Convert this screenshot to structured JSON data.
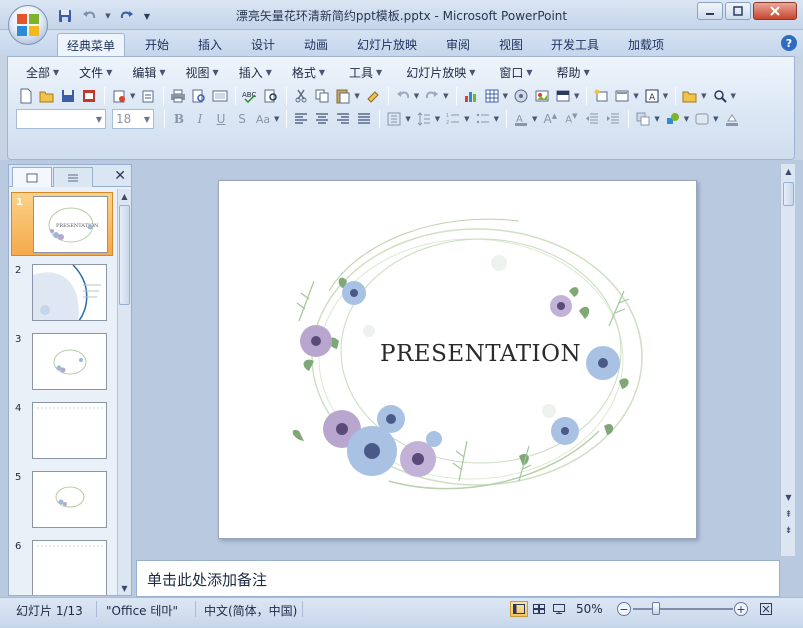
{
  "window": {
    "title": "漂亮矢量花环清新简约ppt模板.pptx - Microsoft PowerPoint"
  },
  "ribbon_tabs": [
    "经典菜单",
    "开始",
    "插入",
    "设计",
    "动画",
    "幻灯片放映",
    "审阅",
    "视图",
    "开发工具",
    "加载项"
  ],
  "classic_menu": [
    {
      "label": "全部"
    },
    {
      "label": "文件"
    },
    {
      "label": "编辑"
    },
    {
      "label": "视图"
    },
    {
      "label": "插入"
    },
    {
      "label": "格式"
    },
    {
      "label": "工具"
    },
    {
      "label": "幻灯片放映"
    },
    {
      "label": "窗口"
    },
    {
      "label": "帮助"
    }
  ],
  "toolbar": {
    "font_name": "",
    "font_size": "18"
  },
  "thumbnails": [
    {
      "number": "1",
      "selected": true
    },
    {
      "number": "2",
      "selected": false
    },
    {
      "number": "3",
      "selected": false
    },
    {
      "number": "4",
      "selected": false
    },
    {
      "number": "5",
      "selected": false
    },
    {
      "number": "6",
      "selected": false
    }
  ],
  "slide": {
    "title_text": "PRESENTATION"
  },
  "notes": {
    "placeholder": "单击此处添加备注"
  },
  "statusbar": {
    "slide_info": "幻灯片 1/13",
    "theme": "\"Office 테마\"",
    "language": "中文(简体，中国)",
    "zoom": "50%"
  },
  "colors": {
    "accent_orange": "#f5a94a",
    "ribbon_blue": "#dae6f4",
    "close_red": "#c8452f"
  }
}
